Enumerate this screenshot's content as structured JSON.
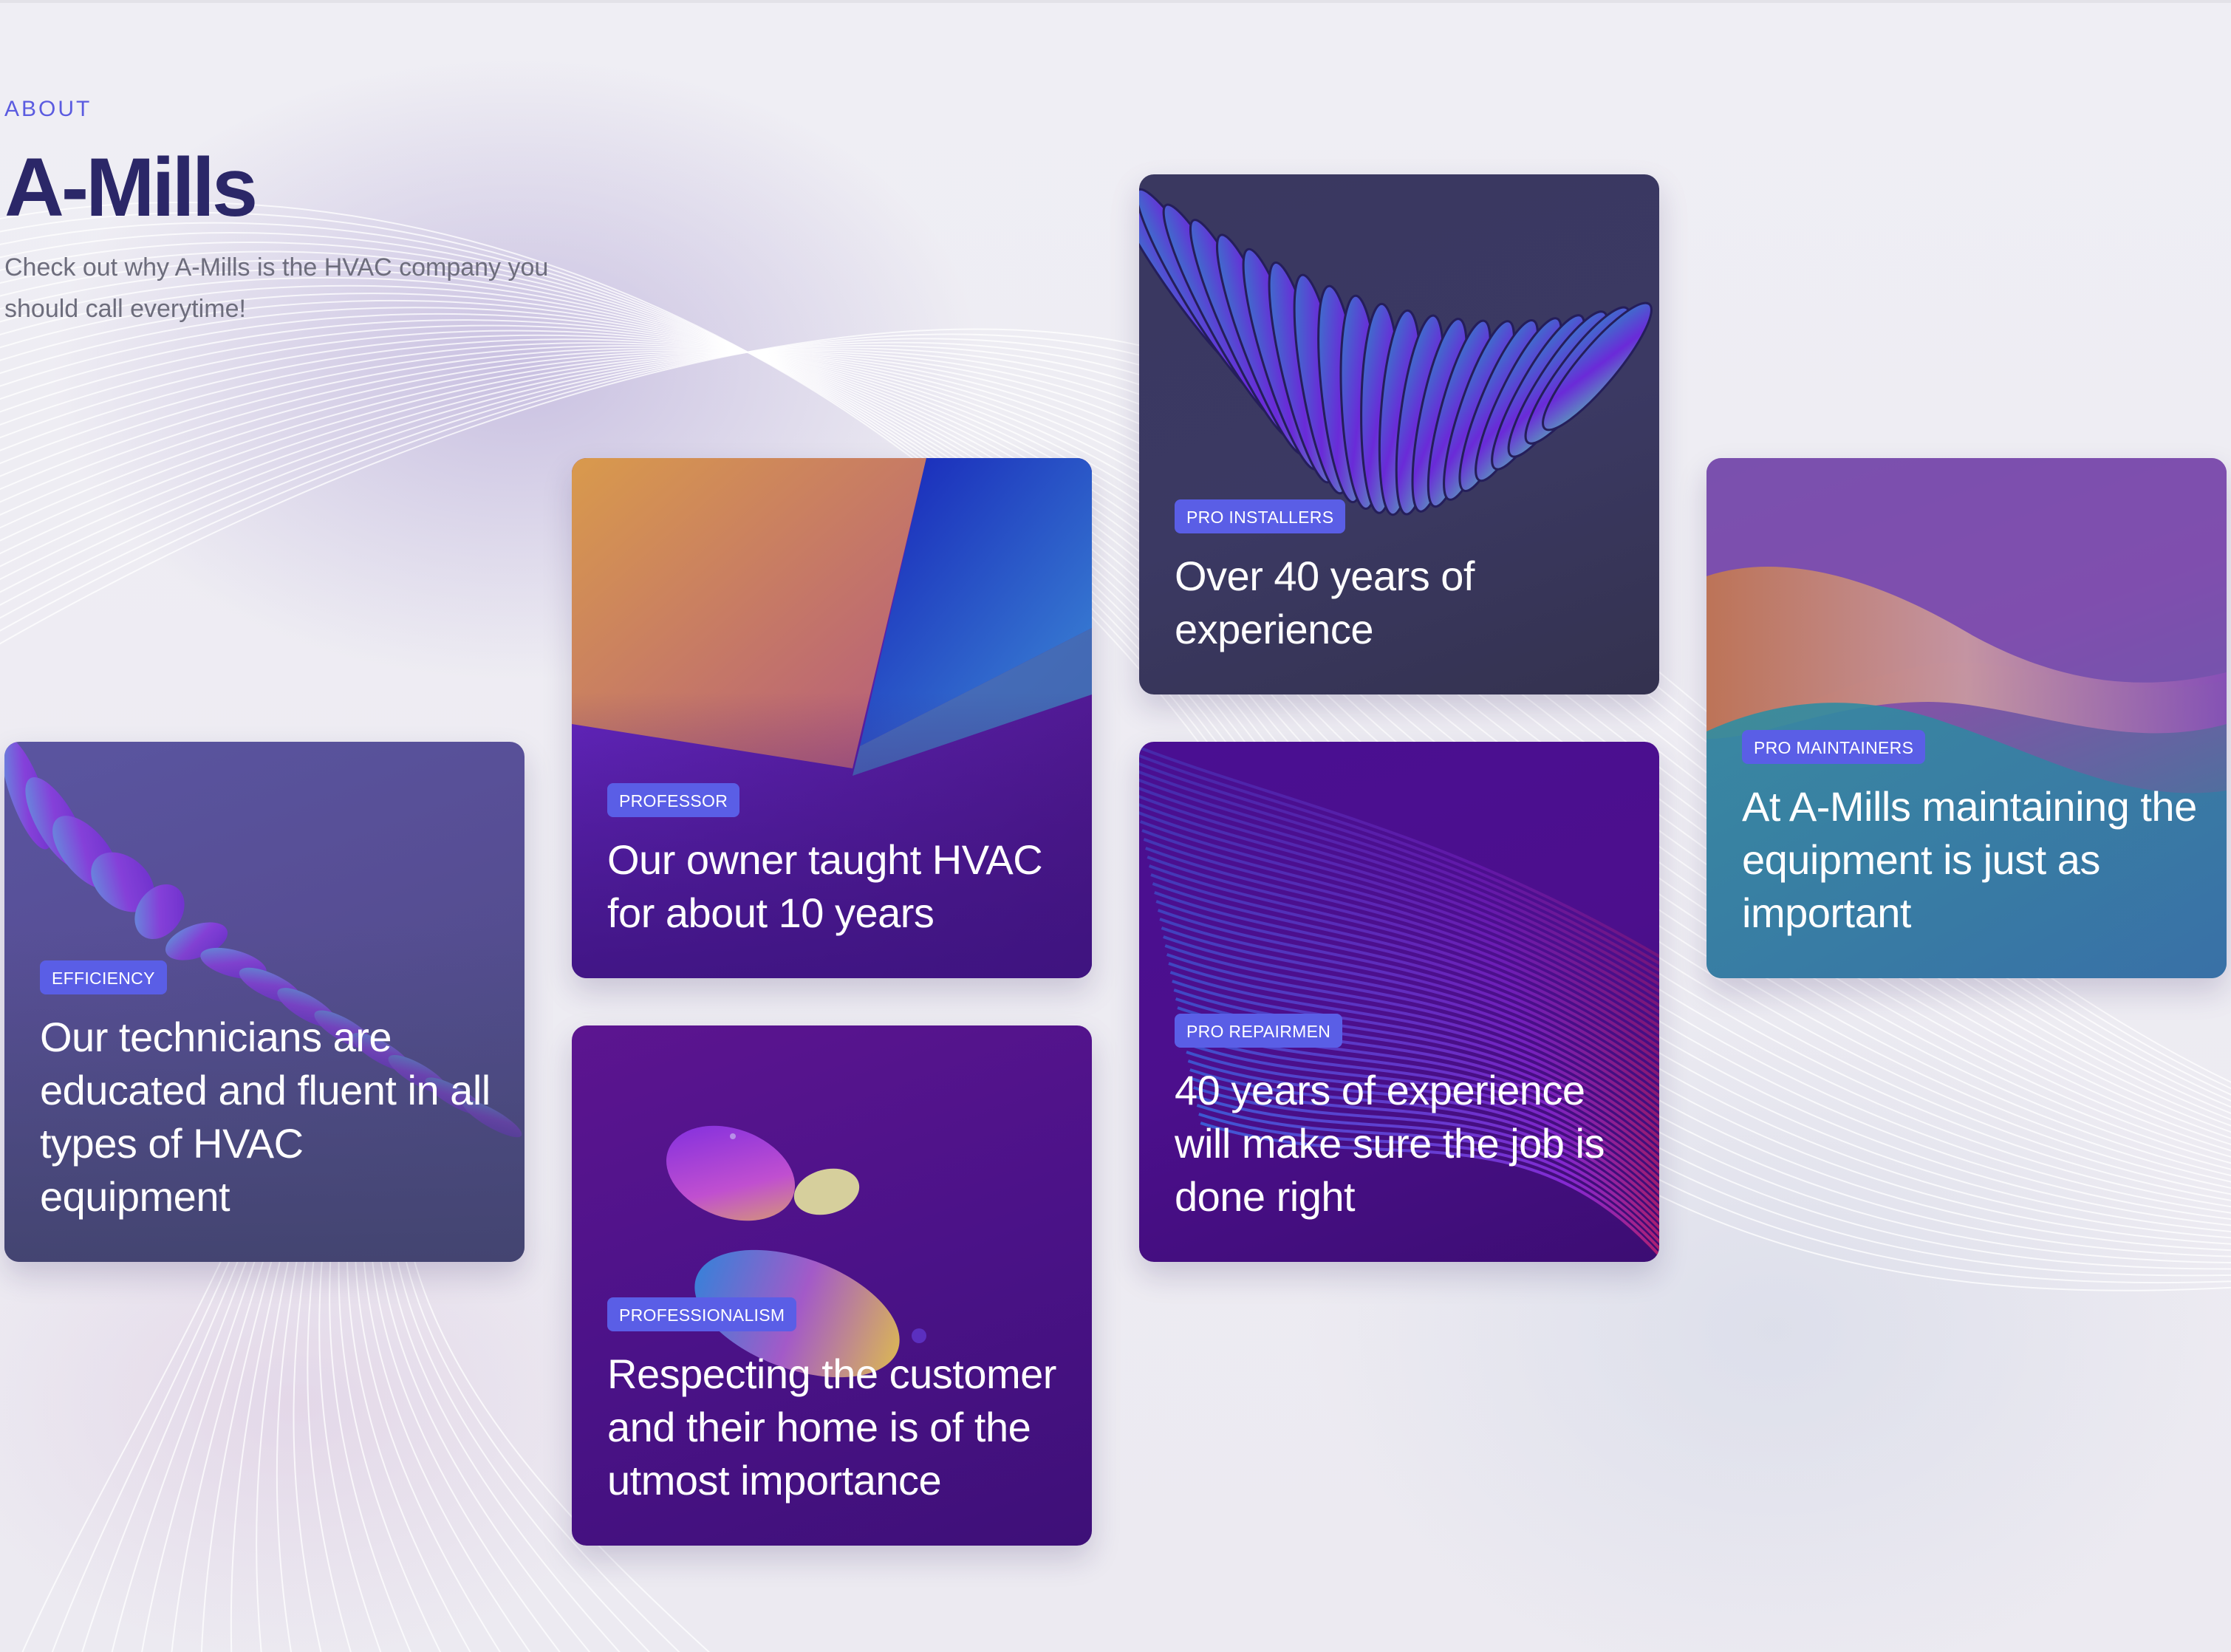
{
  "about": {
    "eyebrow": "ABOUT",
    "title": "A-Mills",
    "subtitle": "Check out why A-Mills is the HVAC company you should call everytime!"
  },
  "cards": [
    {
      "id": "efficiency",
      "badge": "EFFICIENCY",
      "text": "Our technicians are educated and fluent in all types of HVAC equipment"
    },
    {
      "id": "professor",
      "badge": "PROFESSOR",
      "text": "Our owner taught HVAC for about 10 years"
    },
    {
      "id": "professionalism",
      "badge": "PROFESSIONALISM",
      "text": "Respecting the customer and their home is of the utmost importance"
    },
    {
      "id": "installers",
      "badge": "PRO INSTALLERS",
      "text": "Over 40 years of experience"
    },
    {
      "id": "repairmen",
      "badge": "PRO REPAIRMEN",
      "text": "40 years of experience will make sure the job is done right"
    },
    {
      "id": "maintainers",
      "badge": "PRO MAINTAINERS",
      "text": "At A-Mills maintaining the equipment is just as important"
    }
  ],
  "colors": {
    "accent": "#5a5ee6",
    "title": "#2b2768",
    "eyebrow": "#5b5be0",
    "subtitle": "#6d6d7c",
    "background": "#eeedf3"
  }
}
